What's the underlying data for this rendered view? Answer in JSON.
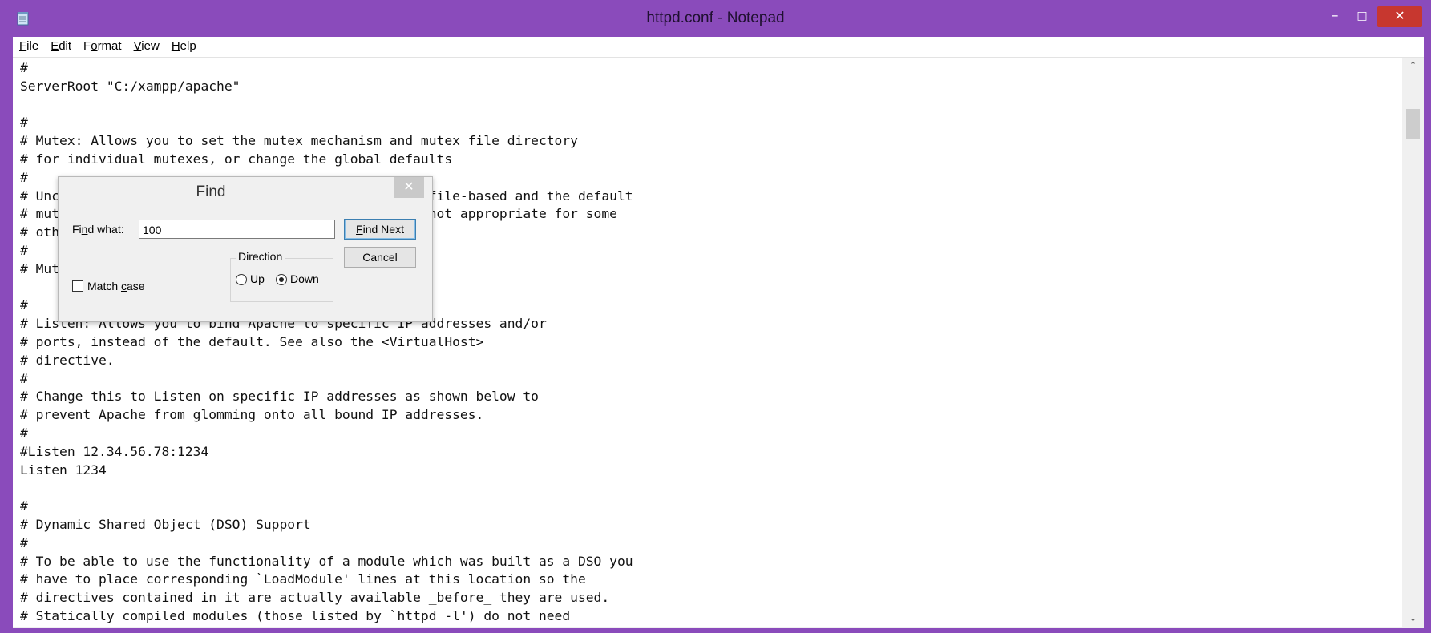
{
  "window": {
    "title": "httpd.conf - Notepad",
    "controls": {
      "minimize": "–",
      "maximize": "□",
      "close": "✕"
    }
  },
  "menubar": {
    "items": [
      {
        "pre": "",
        "key": "F",
        "post": "ile"
      },
      {
        "pre": "",
        "key": "E",
        "post": "dit"
      },
      {
        "pre": "F",
        "key": "o",
        "post": "rmat"
      },
      {
        "pre": "",
        "key": "V",
        "post": "iew"
      },
      {
        "pre": "",
        "key": "H",
        "post": "elp"
      }
    ]
  },
  "editor": {
    "lines": [
      "#",
      "ServerRoot \"C:/xampp/apache\"",
      "",
      "#",
      "# Mutex: Allows you to set the mutex mechanism and mutex file directory",
      "# for individual mutexes, or change the global defaults",
      "#",
      "# Uncomment and change the directory if mutexes are file-based and the default",
      "# mutex file directory is not on a local disk or is not appropriate for some",
      "# other reason.",
      "#",
      "# Mutex default:logs",
      "",
      "#",
      "# Listen: Allows you to bind Apache to specific IP addresses and/or",
      "# ports, instead of the default. See also the <VirtualHost>",
      "# directive.",
      "#",
      "# Change this to Listen on specific IP addresses as shown below to",
      "# prevent Apache from glomming onto all bound IP addresses.",
      "#",
      "#Listen 12.34.56.78:1234",
      "Listen 1234",
      "",
      "#",
      "# Dynamic Shared Object (DSO) Support",
      "#",
      "# To be able to use the functionality of a module which was built as a DSO you",
      "# have to place corresponding `LoadModule' lines at this location so the",
      "# directives contained in it are actually available _before_ they are used.",
      "# Statically compiled modules (those listed by `httpd -l') do not need"
    ]
  },
  "scrollbar": {
    "up_arrow": "⌃",
    "down_arrow": "⌄"
  },
  "find_dialog": {
    "title": "Find",
    "close": "✕",
    "find_what_label_pre": "Fi",
    "find_what_label_key": "n",
    "find_what_label_post": "d what:",
    "find_what_value": "100",
    "find_next_pre": "",
    "find_next_key": "F",
    "find_next_post": "ind Next",
    "cancel_label": "Cancel",
    "direction_label": "Direction",
    "up_key": "U",
    "up_post": "p",
    "down_key": "D",
    "down_post": "own",
    "direction_selected": "Down",
    "match_case_pre": "Match ",
    "match_case_key": "c",
    "match_case_post": "ase",
    "match_case_checked": false
  }
}
